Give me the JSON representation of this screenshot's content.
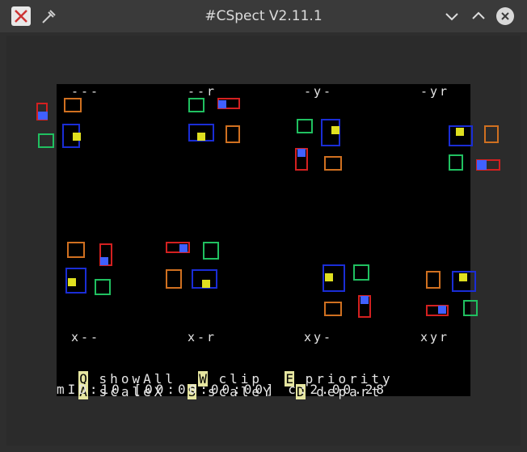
{
  "window": {
    "title": "#CSpect V2.11.1",
    "app_icon": "x-logo-icon",
    "pin_icon": "pin-icon",
    "minimize_icon": "chevron-down-icon",
    "maximize_icon": "chevron-up-icon",
    "close_icon": "close-icon"
  },
  "screen": {
    "top_labels": [
      "---",
      "--r",
      "-y-",
      "-yr"
    ],
    "bottom_labels": [
      "x--",
      "x-r",
      "xy-",
      "xyr"
    ],
    "menu": [
      {
        "key": "Q",
        "label": "showAll",
        "key2": "W",
        "label2": "clip",
        "key3": "E",
        "label3": "priority"
      },
      {
        "key": "A",
        "label": "scaleX",
        "key2": "S",
        "label2": "scaleY",
        "key3": "D",
        "label3": "depart"
      }
    ],
    "status": "mID:10 [00:00:00:00] c:2.00.28"
  },
  "colors": {
    "background": "#000000",
    "window": "#2e2e2e",
    "text": "#e6e6e6",
    "key_highlight": "#e6e6a0",
    "sprite_blue": "#1a2dd6",
    "sprite_red": "#d32020",
    "sprite_yellow": "#e0e020",
    "sprite_green": "#20c060",
    "sprite_orange": "#d07020"
  }
}
